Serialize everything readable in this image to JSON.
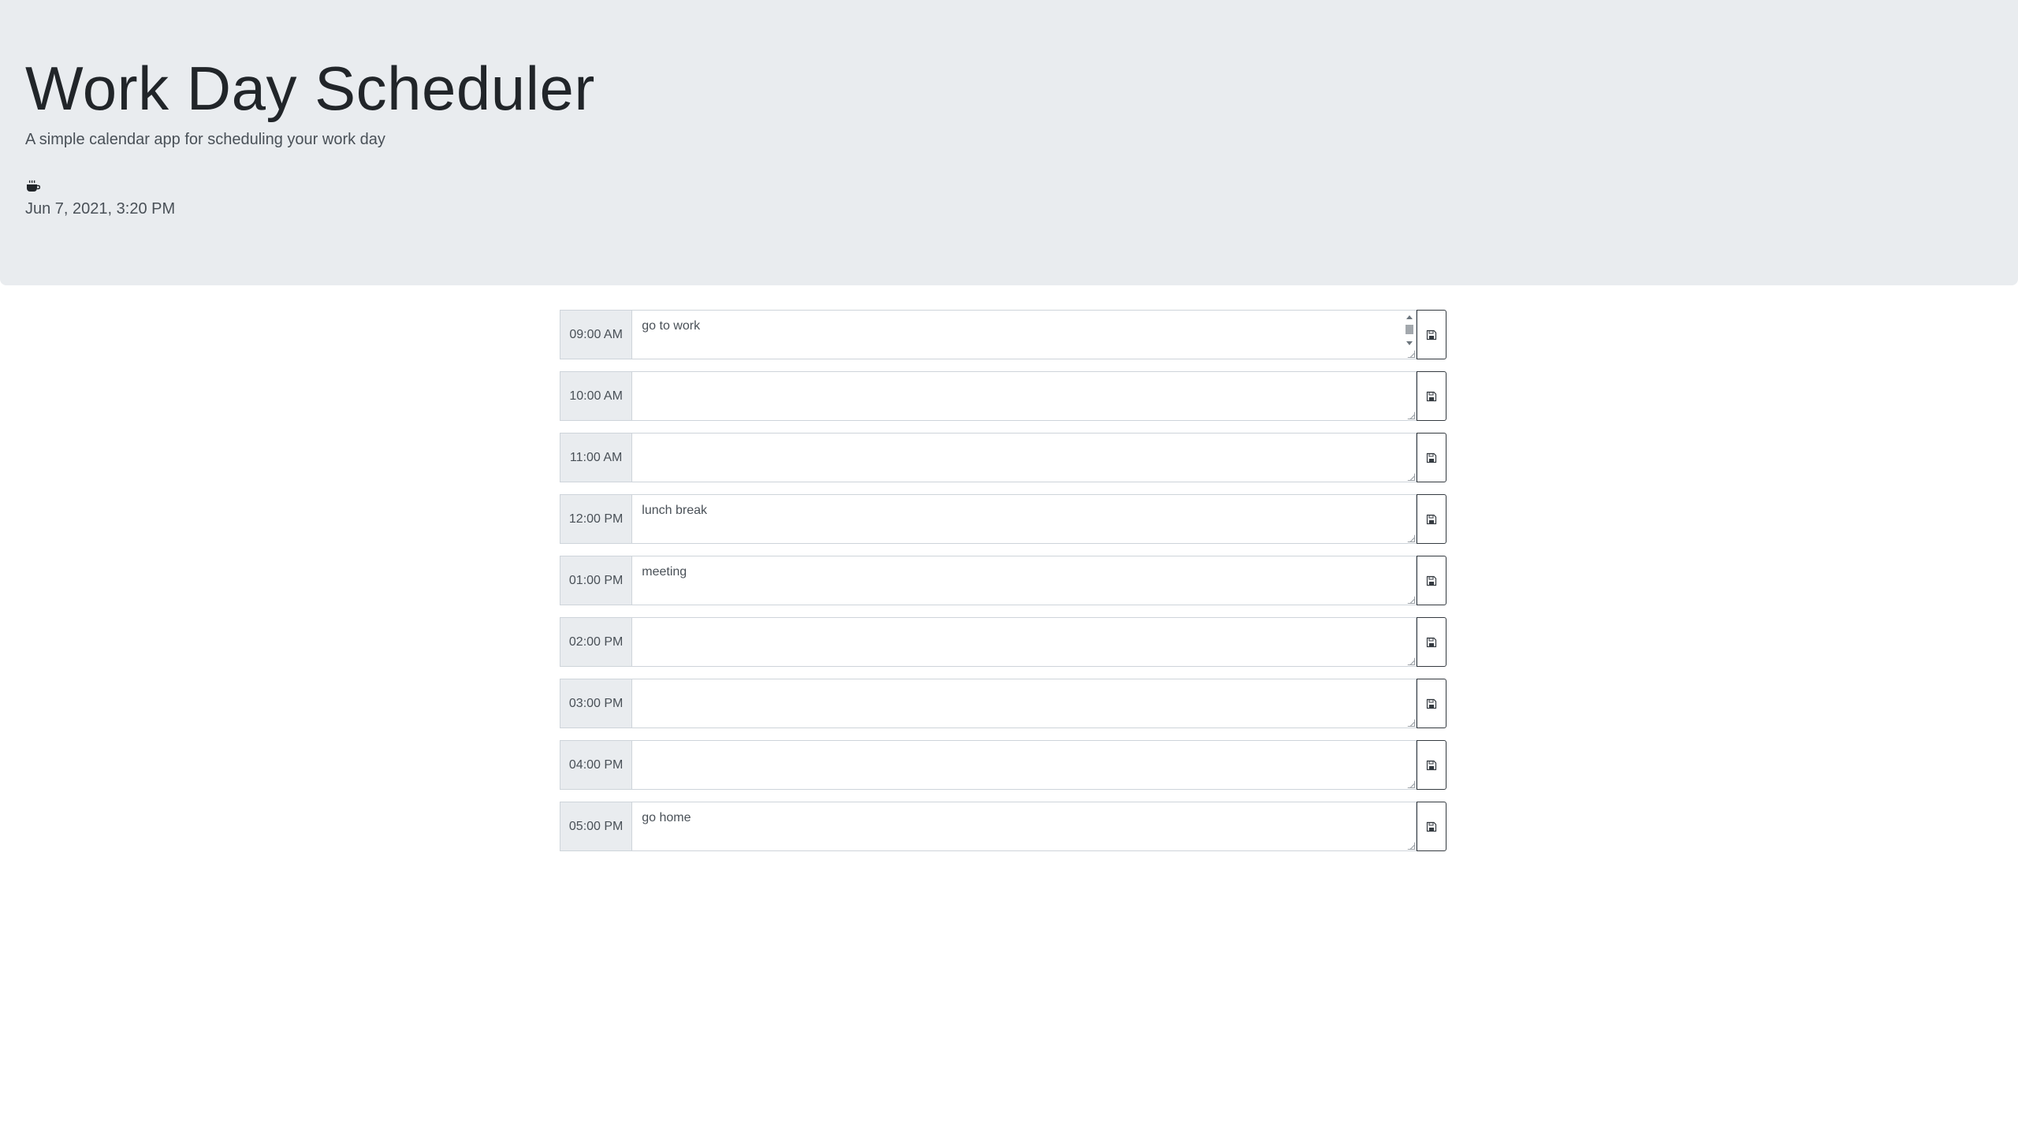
{
  "header": {
    "title": "Work Day Scheduler",
    "subtitle": "A simple calendar app for scheduling your work day",
    "icon": "coffee-icon",
    "date": "Jun 7, 2021, 3:20 PM"
  },
  "colors": {
    "header_bg": "#e9ecef",
    "hour_bg": "#e9ecef",
    "border": "#ced4da",
    "button_border": "#343a40"
  },
  "schedule": [
    {
      "hour": "09:00 AM",
      "text": "go to work"
    },
    {
      "hour": "10:00 AM",
      "text": ""
    },
    {
      "hour": "11:00 AM",
      "text": ""
    },
    {
      "hour": "12:00 PM",
      "text": "lunch break"
    },
    {
      "hour": "01:00 PM",
      "text": "meeting"
    },
    {
      "hour": "02:00 PM",
      "text": ""
    },
    {
      "hour": "03:00 PM",
      "text": ""
    },
    {
      "hour": "04:00 PM",
      "text": ""
    },
    {
      "hour": "05:00 PM",
      "text": "go home"
    }
  ]
}
